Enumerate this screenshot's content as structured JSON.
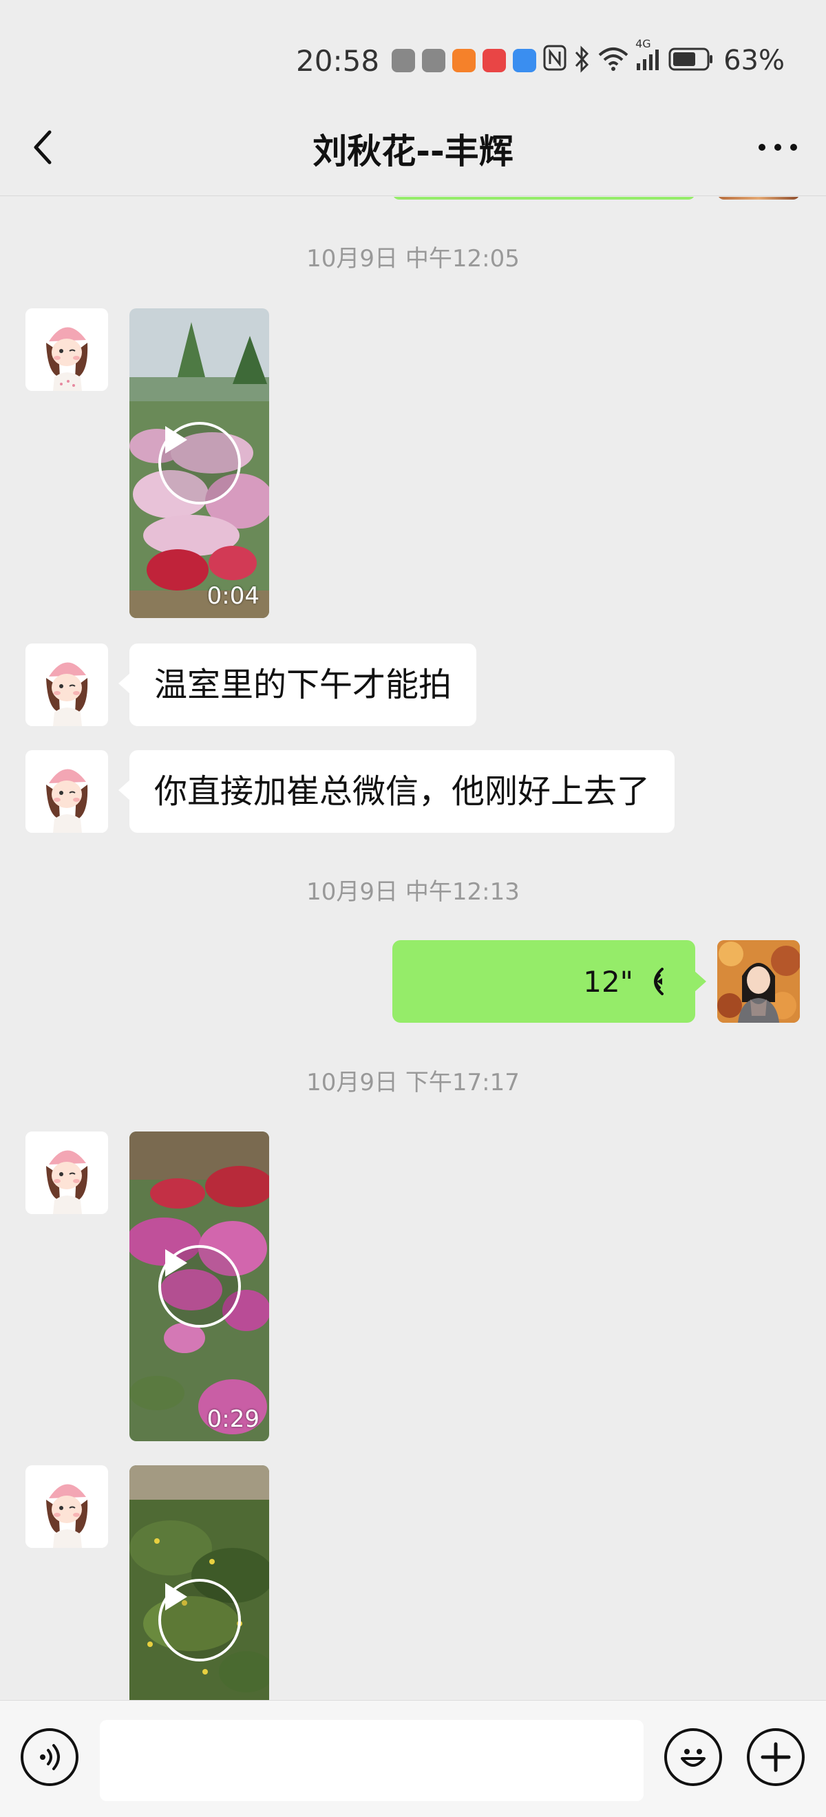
{
  "status_bar": {
    "time": "20:58",
    "battery_percent": "63%",
    "network_label": "4G",
    "app_icon_colors": [
      "#888888",
      "#888888",
      "#f5812a",
      "#e94545",
      "#3a8ef0"
    ]
  },
  "header": {
    "title": "刘秋花--丰辉"
  },
  "messages": [
    {
      "type": "timestamp",
      "text": "10月9日 中午12:05"
    },
    {
      "type": "video",
      "side": "left",
      "duration": "0:04"
    },
    {
      "type": "text",
      "side": "left",
      "text": "温室里的下午才能拍"
    },
    {
      "type": "text",
      "side": "left",
      "text": "你直接加崔总微信，他刚好上去了"
    },
    {
      "type": "timestamp",
      "text": "10月9日 中午12:13"
    },
    {
      "type": "voice",
      "side": "right",
      "duration": "12\""
    },
    {
      "type": "timestamp",
      "text": "10月9日 下午17:17"
    },
    {
      "type": "video",
      "side": "left",
      "duration": "0:29"
    },
    {
      "type": "video",
      "side": "left",
      "duration": ""
    }
  ],
  "input": {
    "value": "",
    "placeholder": ""
  },
  "colors": {
    "background": "#ededed",
    "sent_bubble": "#95ec69",
    "received_bubble": "#ffffff"
  }
}
